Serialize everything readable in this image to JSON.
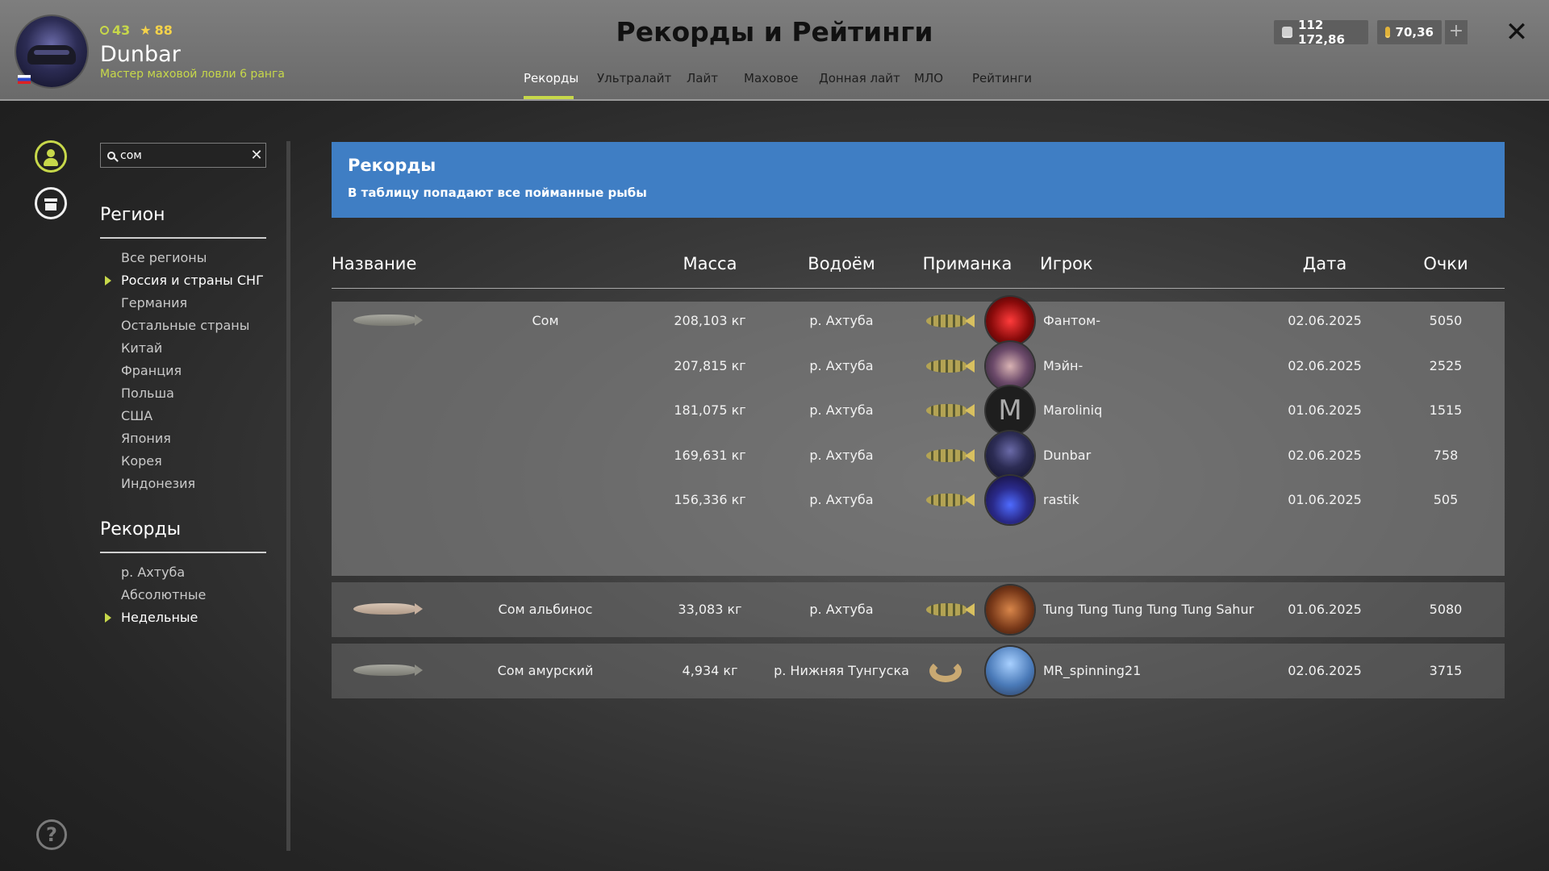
{
  "header": {
    "title": "Рекорды и Рейтинги",
    "player": {
      "name": "Dunbar",
      "level": "43",
      "fame": "88",
      "rank": "Мастер маховой ловли 6 ранга"
    },
    "silver": "112 172,86",
    "gold": "70,36",
    "plus_label": "+",
    "close_label": "✕",
    "tabs": [
      {
        "label": "Рекорды",
        "active": true
      },
      {
        "label": "Ультралайт"
      },
      {
        "label": "Лайт"
      },
      {
        "label": "Маховое"
      },
      {
        "label": "Донная лайт"
      },
      {
        "label": "МЛО"
      },
      {
        "label": "Рейтинги"
      }
    ]
  },
  "sidebar": {
    "search": {
      "value": "сом",
      "clear_label": "✕"
    },
    "region_title": "Регион",
    "regions": [
      "Все регионы",
      "Россия и страны СНГ",
      "Германия",
      "Остальные страны",
      "Китай",
      "Франция",
      "Польша",
      "США",
      "Япония",
      "Корея",
      "Индонезия"
    ],
    "selected_region": "Россия и страны СНГ",
    "records_title": "Рекорды",
    "records": [
      "р. Ахтуба",
      "Абсолютные",
      "Недельные"
    ],
    "selected_record": "Недельные",
    "help_label": "?"
  },
  "banner": {
    "title": "Рекорды",
    "subtitle": "В таблицу попадают все пойманные рыбы"
  },
  "table": {
    "columns": [
      "Название",
      "Масса",
      "Водоём",
      "Приманка",
      "Игрок",
      "Дата",
      "Очки"
    ],
    "rows": [
      {
        "fish": "Сом",
        "mass": "208,103 кг",
        "water": "р. Ахтуба",
        "player": "Фантом-",
        "date": "02.06.2025",
        "points": "5050"
      },
      {
        "fish": "",
        "mass": "207,815 кг",
        "water": "р. Ахтуба",
        "player": "Мэйн-",
        "date": "02.06.2025",
        "points": "2525"
      },
      {
        "fish": "",
        "mass": "181,075 кг",
        "water": "р. Ахтуба",
        "player": "Maroliniq",
        "date": "01.06.2025",
        "points": "1515"
      },
      {
        "fish": "",
        "mass": "169,631 кг",
        "water": "р. Ахтуба",
        "player": "Dunbar",
        "date": "02.06.2025",
        "points": "758"
      },
      {
        "fish": "",
        "mass": "156,336 кг",
        "water": "р. Ахтуба",
        "player": "rastik",
        "date": "01.06.2025",
        "points": "505"
      },
      {
        "fish": "Сом альбинос",
        "mass": "33,083 кг",
        "water": "р. Ахтуба",
        "player": "Tung Tung Tung Tung Tung Sahur",
        "date": "01.06.2025",
        "points": "5080"
      },
      {
        "fish": "Сом амурский",
        "mass": "4,934 кг",
        "water": "р. Нижняя Тунгуска",
        "player": "MR_spinning21",
        "date": "02.06.2025",
        "points": "3715"
      }
    ]
  },
  "colors": {
    "accent": "#c7d84a",
    "banner": "#3f7ec4",
    "header": "#7a7a7a"
  }
}
